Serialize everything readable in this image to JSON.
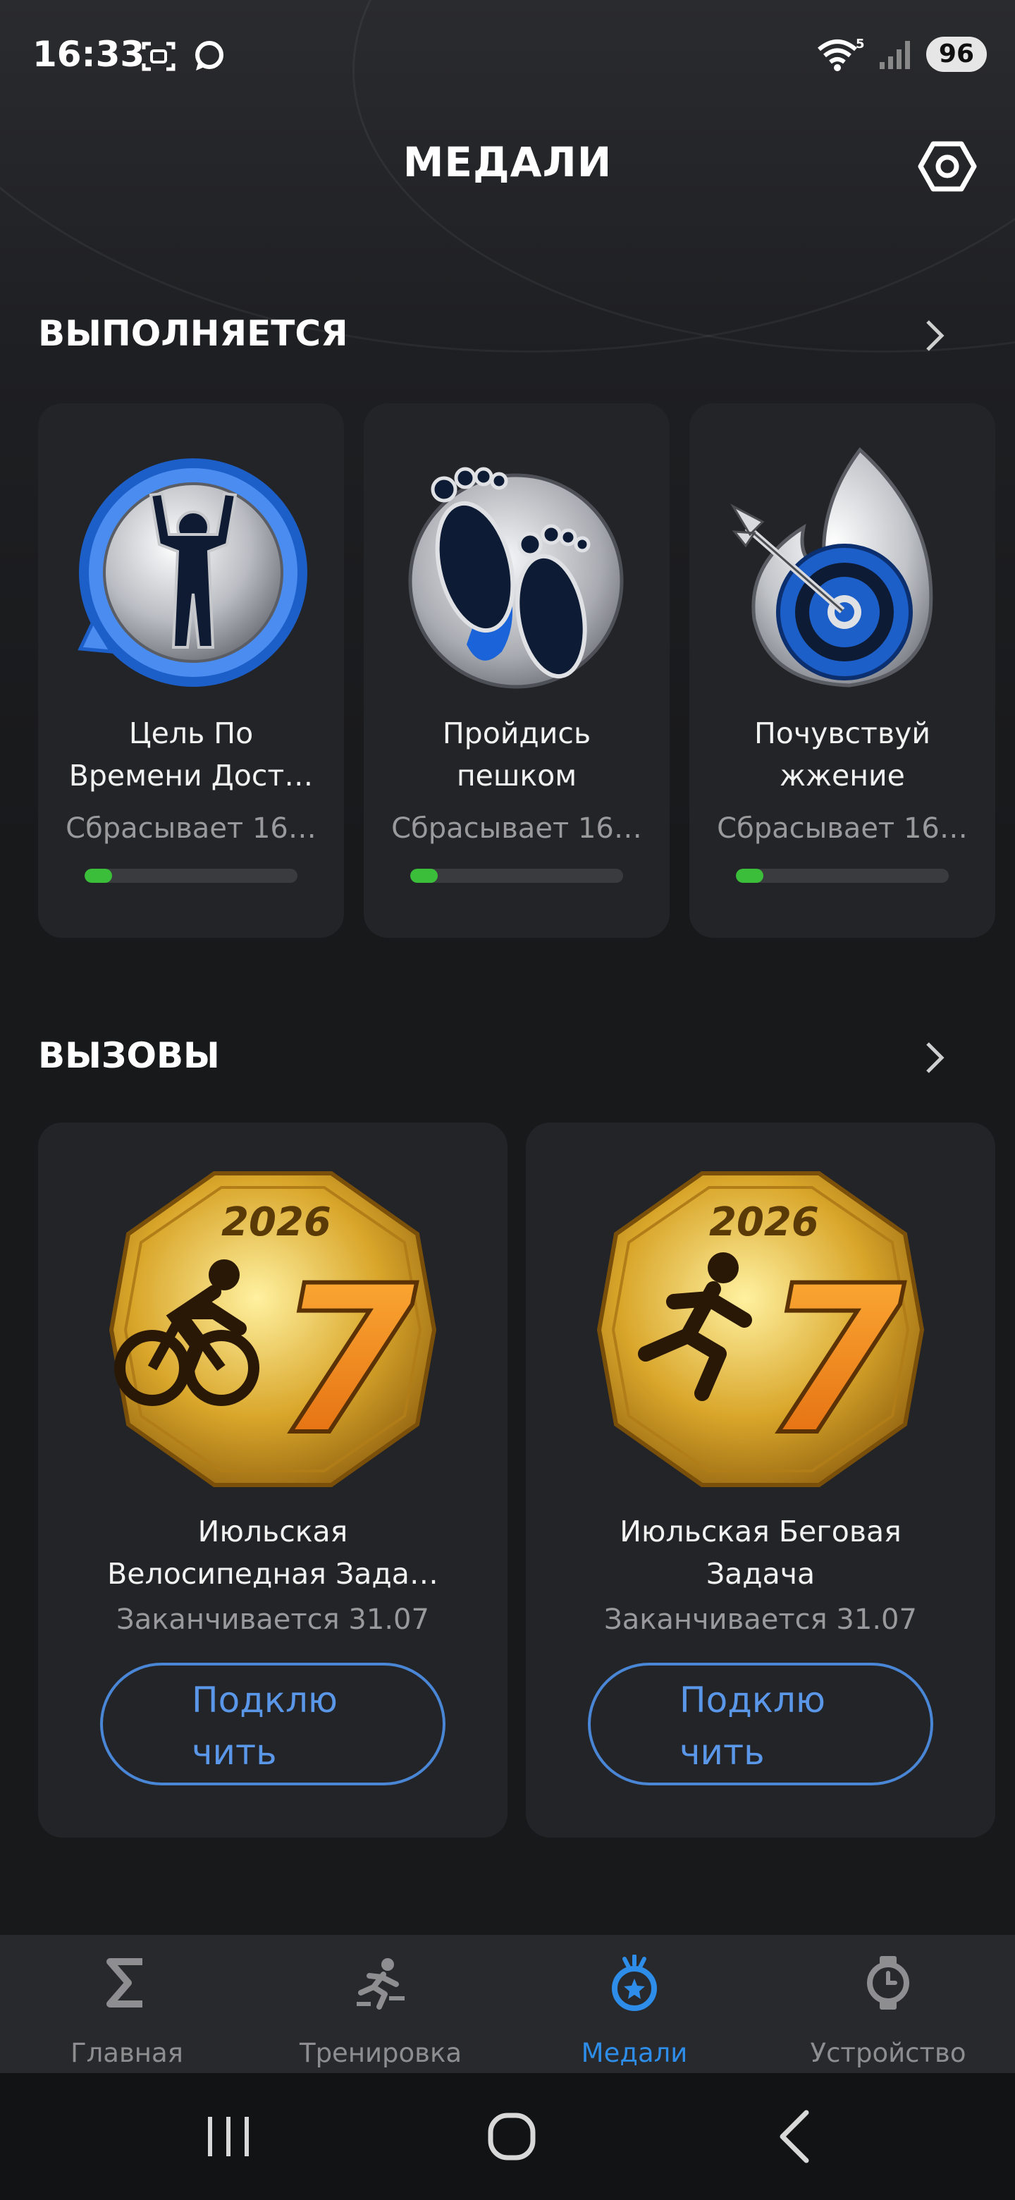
{
  "status_bar": {
    "time": "16:33",
    "battery": "96",
    "wifi_label": "5"
  },
  "header": {
    "title": "МЕДАЛИ",
    "settings_icon": "hexagon-nut-settings-icon"
  },
  "in_progress": {
    "title": "ВЫПОЛНЯЕТСЯ",
    "cards": [
      {
        "title_line1": "Цель По",
        "title_line2": "Времени Дост…",
        "subtitle": "Сбрасывает 16…",
        "progress": 0.13,
        "icon": "time-goal-medal-icon"
      },
      {
        "title_line1": "Пройдись",
        "title_line2": "пешком",
        "subtitle": "Сбрасывает 16…",
        "progress": 0.13,
        "icon": "footprints-medal-icon"
      },
      {
        "title_line1": "Почувствуй",
        "title_line2": "жжение",
        "subtitle": "Сбрасывает 16…",
        "progress": 0.13,
        "icon": "flame-target-medal-icon"
      }
    ]
  },
  "challenges": {
    "title": "ВЫЗОВЫ",
    "cards": [
      {
        "year": "2026",
        "number": "7",
        "title_line1": "Июльская",
        "title_line2": "Велосипедная Зада…",
        "subtitle": "Заканчивается 31.07",
        "button_line1": "Подклю",
        "button_line2": "чить",
        "icon": "cycling-medal-icon"
      },
      {
        "year": "2026",
        "number": "7",
        "title_line1": "Июльская Беговая",
        "title_line2": "Задача",
        "subtitle": "Заканчивается 31.07",
        "button_line1": "Подклю",
        "button_line2": "чить",
        "icon": "running-medal-icon"
      }
    ]
  },
  "bottom_nav": {
    "items": [
      {
        "label": "Главная",
        "icon": "sigma-icon",
        "active": false
      },
      {
        "label": "Тренировка",
        "icon": "workout-runner-icon",
        "active": false
      },
      {
        "label": "Медали",
        "icon": "medal-star-icon",
        "active": true
      },
      {
        "label": "Устройство",
        "icon": "watch-icon",
        "active": false
      }
    ]
  },
  "colors": {
    "accent": "#2e8de8",
    "progress": "#3bbf3b",
    "card_bg": "#232427",
    "button_border": "#4a86d6"
  }
}
